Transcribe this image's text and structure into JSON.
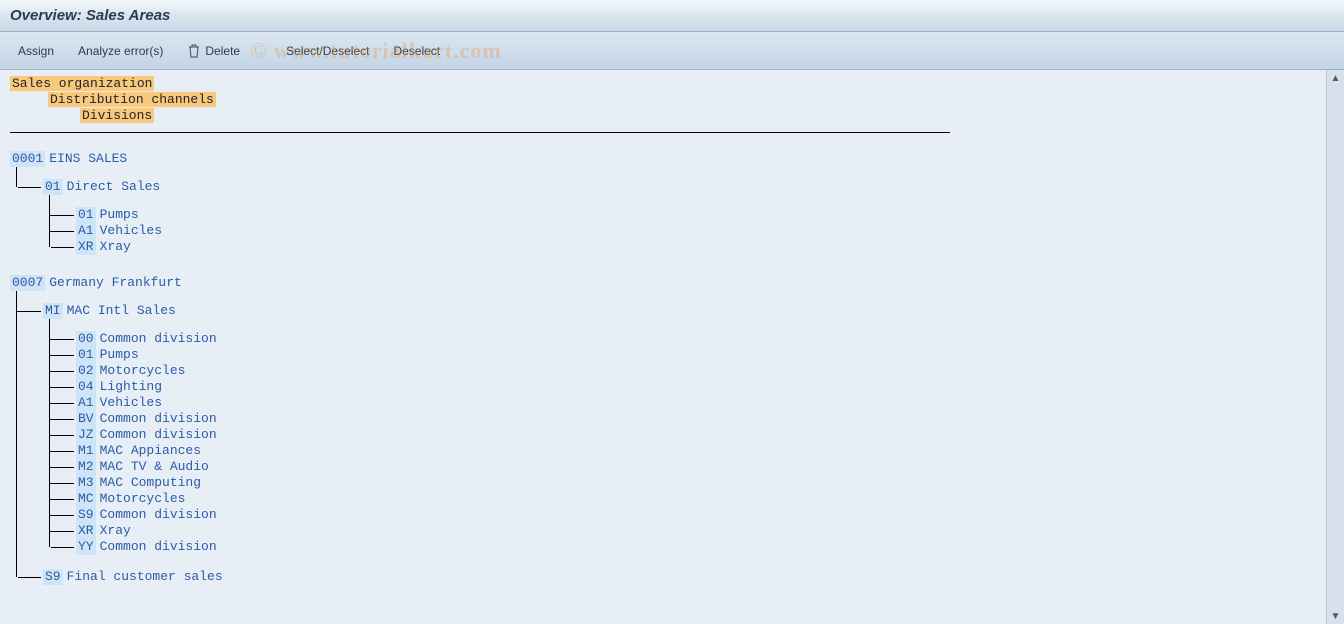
{
  "title": "Overview: Sales Areas",
  "toolbar": {
    "assign": "Assign",
    "analyze": "Analyze error(s)",
    "delete": "Delete",
    "select_deselect": "Select/Deselect",
    "deselect": "Deselect"
  },
  "legend": {
    "l1": "Sales organization",
    "l2": "Distribution channels",
    "l3": "Divisions"
  },
  "tree": [
    {
      "code": "0001",
      "name": "EINS SALES",
      "channels": [
        {
          "code": "01",
          "name": "Direct Sales",
          "divisions": [
            {
              "code": "01",
              "name": "Pumps"
            },
            {
              "code": "A1",
              "name": "Vehicles"
            },
            {
              "code": "XR",
              "name": "Xray"
            }
          ]
        }
      ]
    },
    {
      "code": "0007",
      "name": "Germany Frankfurt",
      "channels": [
        {
          "code": "MI",
          "name": "MAC Intl Sales",
          "divisions": [
            {
              "code": "00",
              "name": "Common division"
            },
            {
              "code": "01",
              "name": "Pumps"
            },
            {
              "code": "02",
              "name": "Motorcycles"
            },
            {
              "code": "04",
              "name": "Lighting"
            },
            {
              "code": "A1",
              "name": "Vehicles"
            },
            {
              "code": "BV",
              "name": "Common division"
            },
            {
              "code": "JZ",
              "name": "Common division"
            },
            {
              "code": "M1",
              "name": "MAC Appiances"
            },
            {
              "code": "M2",
              "name": "MAC TV & Audio"
            },
            {
              "code": "M3",
              "name": "MAC Computing"
            },
            {
              "code": "MC",
              "name": "Motorcycles"
            },
            {
              "code": "S9",
              "name": "Common division"
            },
            {
              "code": "XR",
              "name": "Xray"
            },
            {
              "code": "YY",
              "name": "Common division"
            }
          ]
        },
        {
          "code": "S9",
          "name": "Final customer sales",
          "divisions": []
        }
      ]
    }
  ],
  "watermark": "© www.tutorialkart.com"
}
